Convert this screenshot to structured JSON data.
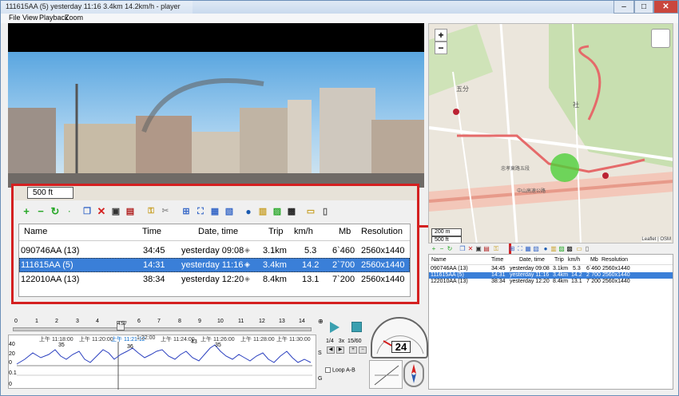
{
  "window": {
    "title": "111615AA (5)   yesterday 11:16   3.4km   14.2km/h - player"
  },
  "menu": [
    "File",
    "View",
    "Playback",
    "Zoom"
  ],
  "overlay": {
    "scale": "500 ft",
    "columns": [
      "Name",
      "Time",
      "Date, time",
      "Trip",
      "km/h",
      "Mb",
      "Resolution"
    ],
    "rows": [
      [
        "090746AA (13)",
        "34:45",
        "yesterday 09:08",
        "3.1km",
        "5.3",
        "6`460",
        "2560x1440"
      ],
      [
        "111615AA (5)",
        "14:31",
        "yesterday 11:16",
        "3.4km",
        "14.2",
        "2`700",
        "2560x1440"
      ],
      [
        "122010AA (13)",
        "38:34",
        "yesterday 12:20",
        "8.4km",
        "13.1",
        "7`200",
        "2560x1440"
      ]
    ],
    "selected_row": 1
  },
  "map": {
    "zoom_in": "+",
    "zoom_out": "−",
    "scale_m": "200 m",
    "scale_ft": "500 ft",
    "attribution": "Leaflet | OSM",
    "labels": [
      "五分",
      "社",
      "忠孝東路五段",
      "中山高速公路"
    ]
  },
  "small_table": {
    "columns": [
      "Name",
      "Time",
      "Date, time",
      "Trip",
      "km/h",
      "Mb",
      "Resolution"
    ],
    "rows": [
      [
        "090746AA (13)",
        "34:45",
        "yesterday 09:08",
        "3.1km",
        "5.3",
        "6`460",
        "2560x1440"
      ],
      [
        "111615AA (5)",
        "14:31",
        "yesterday 11:16",
        "3.4km",
        "14.2",
        "2`700",
        "2560x1440"
      ],
      [
        "122010AA (13)",
        "38:34",
        "yesterday 12:20",
        "8.4km",
        "13.1",
        "7`200",
        "2560x1440"
      ]
    ]
  },
  "timeline": {
    "ticks": [
      "0",
      "1",
      "2",
      "3",
      "4",
      "5",
      "6",
      "7",
      "8",
      "9",
      "10",
      "11",
      "12",
      "13",
      "14"
    ],
    "position": "4:57",
    "times": [
      "上午 11:18:00",
      "上午 11:20:00",
      "上午 11:21:12",
      "1:22:00",
      "上午 11:24:00",
      "上午 11:26:00",
      "上午 11:28:00",
      "上午 11:30:00"
    ],
    "y_ticks": [
      "40",
      "20",
      "0",
      "0.1",
      "0"
    ],
    "peaks": [
      "35",
      "36",
      "43",
      "35"
    ],
    "side_labels": [
      "S",
      "G"
    ]
  },
  "controls": {
    "ratio": "1/4",
    "speed_ratio": "3x",
    "speed_ratio2": "15/60",
    "speed": "24",
    "loop_label": "Loop A-B"
  }
}
